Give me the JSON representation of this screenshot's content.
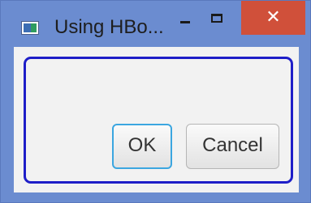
{
  "window": {
    "title": "Using HBo...",
    "minimize_icon": "minimize-icon",
    "maximize_icon": "maximize-icon",
    "close_icon": "close-icon",
    "close_glyph": "✕",
    "close_color": "#d0503a",
    "frame_color": "#6b8cd0"
  },
  "hbox": {
    "border_color": "#1e1ec8"
  },
  "buttons": {
    "ok_label": "OK",
    "cancel_label": "Cancel",
    "focus_color": "#3ba6e0"
  }
}
